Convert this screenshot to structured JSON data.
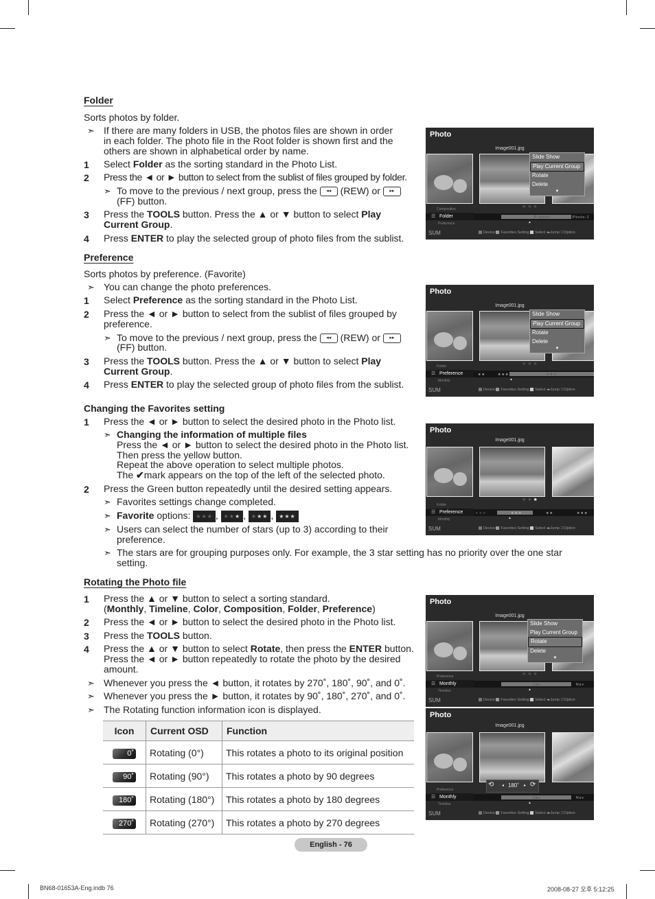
{
  "folder": {
    "title": "Folder",
    "intro": "Sorts photos by folder.",
    "note": [
      "If there are many folders in USB, the photos files are shown in order",
      "in each folder. The photo file in the Root folder is shown first and the",
      "others are shown in alphabetical order by name."
    ],
    "steps": [
      {
        "num": "1",
        "pre": "Select ",
        "bold": "Folder",
        "post": " as the sorting standard in the Photo List."
      },
      {
        "num": "2",
        "text": "Press the ◄ or ► button to select from the sublist of files grouped by folder."
      },
      {
        "num": "3",
        "pre": "Press the ",
        "bold": "TOOLS",
        "post": " button. Press the ▲ or ▼ button to select ",
        "bold2": "Play",
        "line2": "Current Group"
      },
      {
        "num": "4",
        "pre": "Press ",
        "bold": "ENTER",
        "post": " to play the selected group of photo files from the sublist."
      }
    ],
    "subnote_pre": "To move to the previous / next group, press the",
    "subnote_rew": "(REW) or",
    "subnote_ff": "(FF) button."
  },
  "preference": {
    "title": "Preference",
    "intro": "Sorts photos by preference. (Favorite)",
    "note": "You can change the photo preferences.",
    "steps": [
      {
        "num": "1",
        "pre": "Select ",
        "bold": "Preference",
        "post": " as the sorting standard in the Photo List."
      },
      {
        "num": "2",
        "text": "Press the ◄ or ► button to select from the sublist of files grouped by",
        "line2": "preference."
      },
      {
        "num": "3",
        "pre": "Press the ",
        "bold": "TOOLS",
        "post": " button. Press the ▲ or ▼ button to select ",
        "bold2": "Play",
        "line2": "Current Group"
      },
      {
        "num": "4",
        "pre": "Press ",
        "bold": "ENTER",
        "post": " to play the selected group of photo files from the sublist."
      }
    ]
  },
  "favorites": {
    "title": "Changing the Favorites setting",
    "step1": "Press the ◄ or ► button to select the desired photo in the Photo list.",
    "multi_title": "Changing the information of multiple files",
    "multi_lines": [
      "Press the ◄ or ► button to select the desired photo in the Photo list.",
      "Then press the yellow button.",
      "Repeat the above operation to select multiple photos."
    ],
    "check_pre": "The",
    "check_post": "mark appears on the top of the left of the selected photo.",
    "step2": "Press the Green button repeatedly until the desired setting appears.",
    "note1": "Favorites settings change completed.",
    "note2_bold": "Favorite",
    "note2_post": " options:",
    "options": [
      0,
      1,
      2,
      3
    ],
    "note3": [
      "Users can select the number of stars (up to 3) according to their",
      "preference."
    ],
    "note4": [
      "The stars are for grouping purposes only. For example, the 3 star setting has no priority over the one star",
      "setting."
    ]
  },
  "rotating": {
    "title": "Rotating the Photo file",
    "step1": "Press the ▲ or ▼ button to select a sorting standard.",
    "step1_opts": [
      "Monthly",
      "Timeline",
      "Color",
      "Composition",
      "Folder",
      "Preference"
    ],
    "step2": "Press the ◄ or ► button to select the desired photo in the Photo list.",
    "step3_pre": "Press the ",
    "step3_bold": "TOOLS",
    "step3_post": " button.",
    "step4_pre": "Press the ▲ or ▼ button to select ",
    "step4_bold": "Rotate",
    "step4_mid": ", then press the ",
    "step4_bold2": "ENTER",
    "step4_post": " button.",
    "step4_l2": "Press the ◄ or ► button repeatedly to rotate the photo by the desired",
    "step4_l3": "amount.",
    "notes": [
      "Whenever you press the ◄ button, it rotates by 270˚, 180˚, 90˚, and 0˚.",
      "Whenever you press the ► button, it rotates by 90˚, 180˚, 270˚, and 0˚.",
      "The Rotating function information icon is displayed."
    ],
    "table": {
      "headers": [
        "Icon",
        "Current OSD",
        "Function"
      ],
      "rows": [
        {
          "icon": "0˚",
          "osd": "Rotating (0°)",
          "func": "This rotates a photo to its original position"
        },
        {
          "icon": "90˚",
          "osd": "Rotating (90°)",
          "func": "This rotates a photo by 90 degrees"
        },
        {
          "icon": "180˚",
          "osd": "Rotating (180°)",
          "func": "This rotates a photo by 180 degrees"
        },
        {
          "icon": "270˚",
          "osd": "Rotating (270°)",
          "func": "This rotates a photo by 270 degrees"
        }
      ]
    }
  },
  "osd_common": {
    "title": "Photo",
    "filename": "Image001.jpg",
    "menu": [
      "Slide Show",
      "Play Current Group",
      "Rotate",
      "Delete"
    ],
    "sum": "SUM",
    "legend": {
      "device": "Device",
      "fav": "Favorites Setting",
      "select": "Select",
      "jump": "Jump",
      "option": "Option"
    },
    "stars": "★★★"
  },
  "osd1": {
    "cat_up": "Composition",
    "cat": "Folder",
    "cat_down": "Preference",
    "bar_label": "P-other",
    "bar_right": "Photo-1",
    "selected_menu": 1
  },
  "osd2": {
    "cat_up": "Folder",
    "cat": "Preference",
    "cat_down": "Monthly",
    "seg1": "★★",
    "seg2": "★★★",
    "seg3": "★★★",
    "selected_menu": 1
  },
  "osd3": {
    "cat_up": "Folder",
    "cat": "Preference",
    "cat_down": "Monthly",
    "seg0": "★★★",
    "seg1": "★★★",
    "seg2": "★★",
    "seg3": "★★★"
  },
  "osd4": {
    "cat_up": "Preference",
    "cat": "Monthly",
    "cat_down": "Timeline",
    "bar_label": "Jan",
    "bar_right": "Nov",
    "selected_menu": 2
  },
  "osd5": {
    "cat_up": "Preference",
    "cat": "Monthly",
    "cat_down": "Timeline",
    "bar_label": "Jan",
    "bar_right": "Nov",
    "rotate_value": "180˚"
  },
  "page": {
    "label": "English - 76"
  },
  "footer": {
    "left": "BN68-01653A-Eng.indb   76",
    "right": "2008-08-27   오후 5:12:25"
  }
}
